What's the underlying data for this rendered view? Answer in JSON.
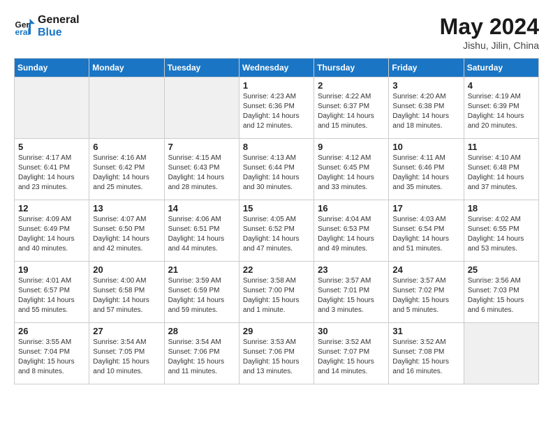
{
  "header": {
    "logo_line1": "General",
    "logo_line2": "Blue",
    "month": "May 2024",
    "location": "Jishu, Jilin, China"
  },
  "weekdays": [
    "Sunday",
    "Monday",
    "Tuesday",
    "Wednesday",
    "Thursday",
    "Friday",
    "Saturday"
  ],
  "weeks": [
    [
      {
        "day": "",
        "empty": true
      },
      {
        "day": "",
        "empty": true
      },
      {
        "day": "",
        "empty": true
      },
      {
        "day": "1",
        "sunrise": "4:23 AM",
        "sunset": "6:36 PM",
        "daylight": "14 hours and 12 minutes."
      },
      {
        "day": "2",
        "sunrise": "4:22 AM",
        "sunset": "6:37 PM",
        "daylight": "14 hours and 15 minutes."
      },
      {
        "day": "3",
        "sunrise": "4:20 AM",
        "sunset": "6:38 PM",
        "daylight": "14 hours and 18 minutes."
      },
      {
        "day": "4",
        "sunrise": "4:19 AM",
        "sunset": "6:39 PM",
        "daylight": "14 hours and 20 minutes."
      }
    ],
    [
      {
        "day": "5",
        "sunrise": "4:17 AM",
        "sunset": "6:41 PM",
        "daylight": "14 hours and 23 minutes."
      },
      {
        "day": "6",
        "sunrise": "4:16 AM",
        "sunset": "6:42 PM",
        "daylight": "14 hours and 25 minutes."
      },
      {
        "day": "7",
        "sunrise": "4:15 AM",
        "sunset": "6:43 PM",
        "daylight": "14 hours and 28 minutes."
      },
      {
        "day": "8",
        "sunrise": "4:13 AM",
        "sunset": "6:44 PM",
        "daylight": "14 hours and 30 minutes."
      },
      {
        "day": "9",
        "sunrise": "4:12 AM",
        "sunset": "6:45 PM",
        "daylight": "14 hours and 33 minutes."
      },
      {
        "day": "10",
        "sunrise": "4:11 AM",
        "sunset": "6:46 PM",
        "daylight": "14 hours and 35 minutes."
      },
      {
        "day": "11",
        "sunrise": "4:10 AM",
        "sunset": "6:48 PM",
        "daylight": "14 hours and 37 minutes."
      }
    ],
    [
      {
        "day": "12",
        "sunrise": "4:09 AM",
        "sunset": "6:49 PM",
        "daylight": "14 hours and 40 minutes."
      },
      {
        "day": "13",
        "sunrise": "4:07 AM",
        "sunset": "6:50 PM",
        "daylight": "14 hours and 42 minutes."
      },
      {
        "day": "14",
        "sunrise": "4:06 AM",
        "sunset": "6:51 PM",
        "daylight": "14 hours and 44 minutes."
      },
      {
        "day": "15",
        "sunrise": "4:05 AM",
        "sunset": "6:52 PM",
        "daylight": "14 hours and 47 minutes."
      },
      {
        "day": "16",
        "sunrise": "4:04 AM",
        "sunset": "6:53 PM",
        "daylight": "14 hours and 49 minutes."
      },
      {
        "day": "17",
        "sunrise": "4:03 AM",
        "sunset": "6:54 PM",
        "daylight": "14 hours and 51 minutes."
      },
      {
        "day": "18",
        "sunrise": "4:02 AM",
        "sunset": "6:55 PM",
        "daylight": "14 hours and 53 minutes."
      }
    ],
    [
      {
        "day": "19",
        "sunrise": "4:01 AM",
        "sunset": "6:57 PM",
        "daylight": "14 hours and 55 minutes."
      },
      {
        "day": "20",
        "sunrise": "4:00 AM",
        "sunset": "6:58 PM",
        "daylight": "14 hours and 57 minutes."
      },
      {
        "day": "21",
        "sunrise": "3:59 AM",
        "sunset": "6:59 PM",
        "daylight": "14 hours and 59 minutes."
      },
      {
        "day": "22",
        "sunrise": "3:58 AM",
        "sunset": "7:00 PM",
        "daylight": "15 hours and 1 minute."
      },
      {
        "day": "23",
        "sunrise": "3:57 AM",
        "sunset": "7:01 PM",
        "daylight": "15 hours and 3 minutes."
      },
      {
        "day": "24",
        "sunrise": "3:57 AM",
        "sunset": "7:02 PM",
        "daylight": "15 hours and 5 minutes."
      },
      {
        "day": "25",
        "sunrise": "3:56 AM",
        "sunset": "7:03 PM",
        "daylight": "15 hours and 6 minutes."
      }
    ],
    [
      {
        "day": "26",
        "sunrise": "3:55 AM",
        "sunset": "7:04 PM",
        "daylight": "15 hours and 8 minutes."
      },
      {
        "day": "27",
        "sunrise": "3:54 AM",
        "sunset": "7:05 PM",
        "daylight": "15 hours and 10 minutes."
      },
      {
        "day": "28",
        "sunrise": "3:54 AM",
        "sunset": "7:06 PM",
        "daylight": "15 hours and 11 minutes."
      },
      {
        "day": "29",
        "sunrise": "3:53 AM",
        "sunset": "7:06 PM",
        "daylight": "15 hours and 13 minutes."
      },
      {
        "day": "30",
        "sunrise": "3:52 AM",
        "sunset": "7:07 PM",
        "daylight": "15 hours and 14 minutes."
      },
      {
        "day": "31",
        "sunrise": "3:52 AM",
        "sunset": "7:08 PM",
        "daylight": "15 hours and 16 minutes."
      },
      {
        "day": "",
        "empty": true
      }
    ]
  ]
}
